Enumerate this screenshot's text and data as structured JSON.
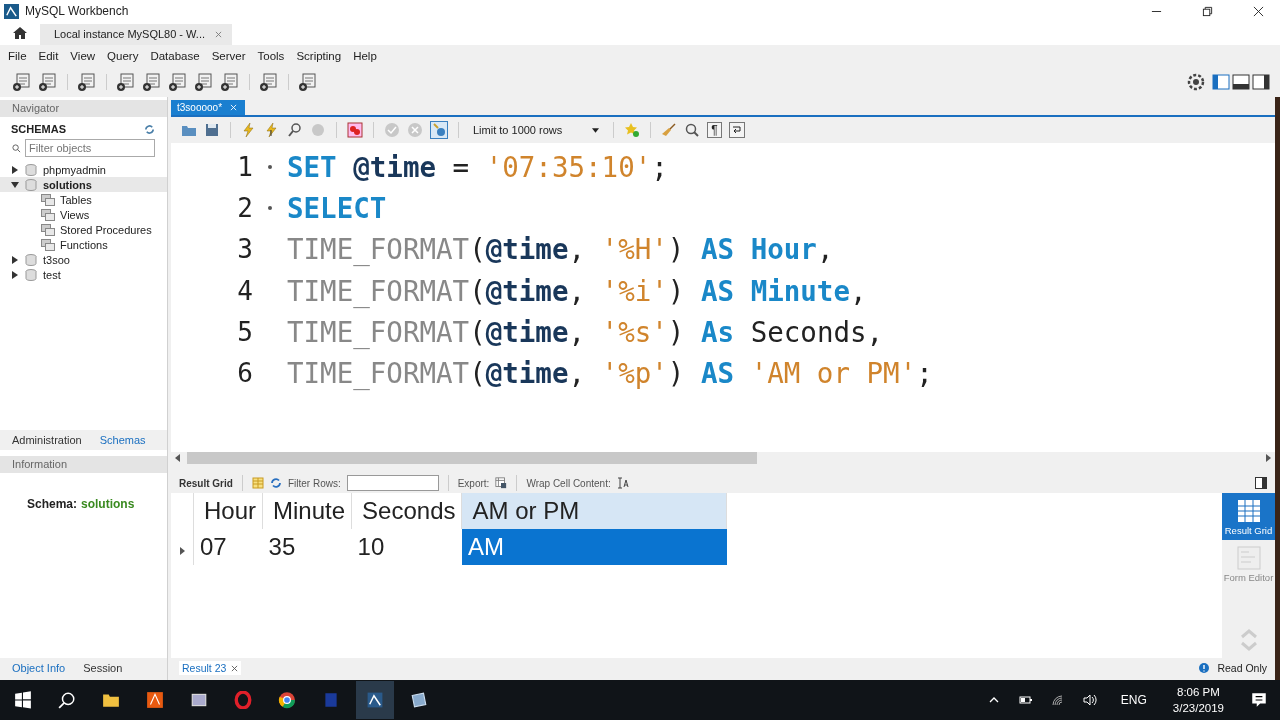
{
  "window": {
    "title": "MySQL Workbench"
  },
  "connection_tabs": [
    {
      "label": "Local instance MySQL80 - W...",
      "selected": true
    }
  ],
  "menu": [
    "File",
    "Edit",
    "View",
    "Query",
    "Database",
    "Server",
    "Tools",
    "Scripting",
    "Help"
  ],
  "navigator": {
    "title": "Navigator",
    "section": "SCHEMAS",
    "filter_placeholder": "Filter objects",
    "schemas": [
      {
        "name": "phpmyadmin",
        "expanded": false,
        "selected": false
      },
      {
        "name": "solutions",
        "expanded": true,
        "selected": true,
        "children": [
          {
            "name": "Tables",
            "selected": false
          },
          {
            "name": "Views",
            "selected": false
          },
          {
            "name": "Stored Procedures",
            "selected": false
          },
          {
            "name": "Functions",
            "selected": false
          }
        ]
      },
      {
        "name": "t3soo",
        "expanded": false,
        "selected": false
      },
      {
        "name": "test",
        "expanded": false,
        "selected": false
      }
    ],
    "tabs": [
      {
        "label": "Administration",
        "selected": false
      },
      {
        "label": "Schemas",
        "selected": true
      }
    ],
    "information": {
      "title": "Information",
      "label": "Schema:",
      "value": "solutions"
    },
    "bottom_tabs": [
      {
        "label": "Object Info",
        "selected": true
      },
      {
        "label": "Session",
        "selected": false
      }
    ]
  },
  "editor": {
    "tabs": [
      {
        "label": "t3sooooo*",
        "selected": true
      }
    ],
    "limit": "Limit to 1000 rows",
    "paragraph": "¶",
    "lines": [
      {
        "number": "1",
        "dot": true,
        "tokens": [
          {
            "kind": "kw",
            "text": "SET "
          },
          {
            "kind": "var",
            "text": "@time"
          },
          {
            "kind": "plain",
            "text": " = "
          },
          {
            "kind": "str",
            "text": "'07:35:10'"
          },
          {
            "kind": "plain",
            "text": ";"
          }
        ]
      },
      {
        "number": "2",
        "dot": true,
        "tokens": [
          {
            "kind": "kw",
            "text": "SELECT"
          }
        ]
      },
      {
        "number": "3",
        "dot": false,
        "tokens": [
          {
            "kind": "fn",
            "text": "TIME_FORMAT"
          },
          {
            "kind": "plain",
            "text": "("
          },
          {
            "kind": "var",
            "text": "@time"
          },
          {
            "kind": "plain",
            "text": ", "
          },
          {
            "kind": "str",
            "text": "'%H'"
          },
          {
            "kind": "plain",
            "text": ") "
          },
          {
            "kind": "kw",
            "text": "AS Hour"
          },
          {
            "kind": "plain",
            "text": ","
          }
        ]
      },
      {
        "number": "4",
        "dot": false,
        "tokens": [
          {
            "kind": "fn",
            "text": "TIME_FORMAT"
          },
          {
            "kind": "plain",
            "text": "("
          },
          {
            "kind": "var",
            "text": "@time"
          },
          {
            "kind": "plain",
            "text": ", "
          },
          {
            "kind": "str",
            "text": "'%i'"
          },
          {
            "kind": "plain",
            "text": ") "
          },
          {
            "kind": "kw",
            "text": "AS Minute"
          },
          {
            "kind": "plain",
            "text": ","
          }
        ]
      },
      {
        "number": "5",
        "dot": false,
        "tokens": [
          {
            "kind": "fn",
            "text": "TIME_FORMAT"
          },
          {
            "kind": "plain",
            "text": "("
          },
          {
            "kind": "var",
            "text": "@time"
          },
          {
            "kind": "plain",
            "text": ", "
          },
          {
            "kind": "str",
            "text": "'%s'"
          },
          {
            "kind": "plain",
            "text": ") "
          },
          {
            "kind": "kw",
            "text": "As"
          },
          {
            "kind": "plain",
            "text": " Seconds,"
          }
        ]
      },
      {
        "number": "6",
        "dot": false,
        "tokens": [
          {
            "kind": "fn",
            "text": "TIME_FORMAT"
          },
          {
            "kind": "plain",
            "text": "("
          },
          {
            "kind": "var",
            "text": "@time"
          },
          {
            "kind": "plain",
            "text": ", "
          },
          {
            "kind": "str",
            "text": "'%p'"
          },
          {
            "kind": "plain",
            "text": ") "
          },
          {
            "kind": "kw",
            "text": "AS "
          },
          {
            "kind": "str",
            "text": "'AM or PM'"
          },
          {
            "kind": "plain",
            "text": ";"
          }
        ]
      }
    ]
  },
  "results": {
    "toolbar": {
      "title": "Result Grid",
      "filter_label": "Filter Rows:",
      "export_label": "Export:",
      "wrap_label": "Wrap Cell Content:"
    },
    "columns": [
      {
        "label": "Hour",
        "selected": false
      },
      {
        "label": "Minute",
        "selected": false
      },
      {
        "label": "Seconds",
        "selected": false
      },
      {
        "label": "AM or PM",
        "selected": true
      }
    ],
    "rows": [
      {
        "cells": [
          {
            "text": "07",
            "selected": false
          },
          {
            "text": "35",
            "selected": false
          },
          {
            "text": "10",
            "selected": false
          },
          {
            "text": "AM",
            "selected": true
          }
        ]
      }
    ],
    "side_tabs": [
      {
        "label": "Result Grid",
        "selected": true
      },
      {
        "label": "Form Editor",
        "selected": false
      }
    ],
    "tabs": [
      {
        "label": "Result 23",
        "selected": true
      }
    ],
    "status": "Read Only"
  },
  "taskbar": {
    "language": "ENG",
    "time": "8:06 PM",
    "date": "3/23/2019"
  }
}
